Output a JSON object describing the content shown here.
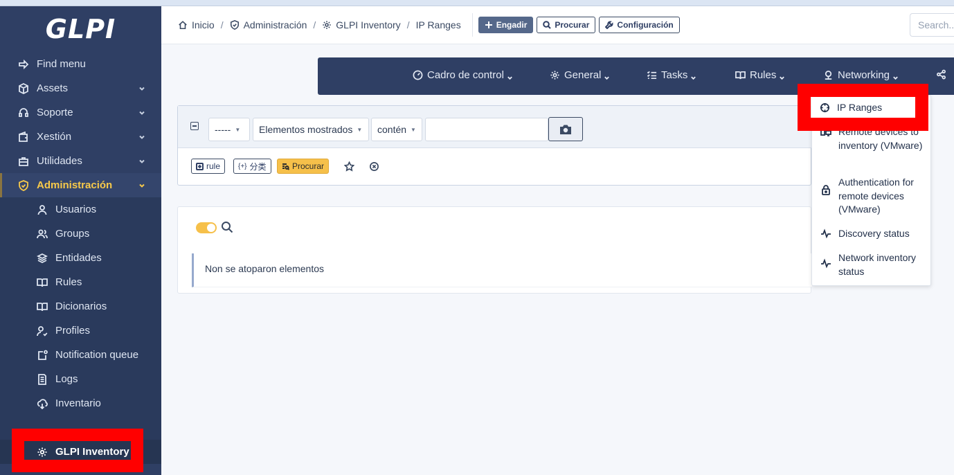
{
  "sidebar": {
    "logo": "GLPI",
    "items": [
      {
        "label": "Find menu",
        "icon": "arrow-right-icon"
      },
      {
        "label": "Assets",
        "icon": "box-icon"
      },
      {
        "label": "Soporte",
        "icon": "headset-icon"
      },
      {
        "label": "Xestión",
        "icon": "wallet-icon"
      },
      {
        "label": "Utilidades",
        "icon": "briefcase-icon"
      },
      {
        "label": "Administración",
        "icon": "shield-check-icon"
      }
    ],
    "sub_items": [
      {
        "label": "Usuarios",
        "icon": "user-icon"
      },
      {
        "label": "Groups",
        "icon": "users-icon"
      },
      {
        "label": "Entidades",
        "icon": "layers-icon"
      },
      {
        "label": "Rules",
        "icon": "book-icon"
      },
      {
        "label": "Dicionarios",
        "icon": "book-icon"
      },
      {
        "label": "Profiles",
        "icon": "user-check-icon"
      },
      {
        "label": "Notification queue",
        "icon": "notification-icon"
      },
      {
        "label": "Logs",
        "icon": "log-icon"
      },
      {
        "label": "Inventario",
        "icon": "cloud-download-icon"
      },
      {
        "label": "GLPI Inventory",
        "icon": "gear-icon"
      }
    ]
  },
  "header": {
    "breadcrumbs": [
      "Inicio",
      "Administración",
      "GLPI Inventory",
      "IP Ranges"
    ],
    "add_label": "Engadir",
    "search_label": "Procurar",
    "config_label": "Configuración",
    "search_placeholder": "Search..."
  },
  "plugin_menu": {
    "items": [
      "Cadro de control",
      "General",
      "Tasks",
      "Rules",
      "Networking"
    ]
  },
  "dropdown": {
    "items": [
      "IP Ranges",
      "Remote devices to inventory (VMware)",
      "Authentication for remote devices (VMware)",
      "Discovery status",
      "Network inventory status"
    ]
  },
  "search_panel": {
    "field_select": "-----",
    "items_select": "Elementos mostrados",
    "condition_select": "contén",
    "value": "",
    "rule_btn": "rule",
    "group_btn": "分类",
    "submit_btn": "Procurar"
  },
  "results": {
    "empty_message": "Non se atoparon elementos"
  },
  "colors": {
    "sidebar_bg": "#2f3f64",
    "accent_yellow": "#f6c04a",
    "highlight_red": "#ff0000"
  }
}
